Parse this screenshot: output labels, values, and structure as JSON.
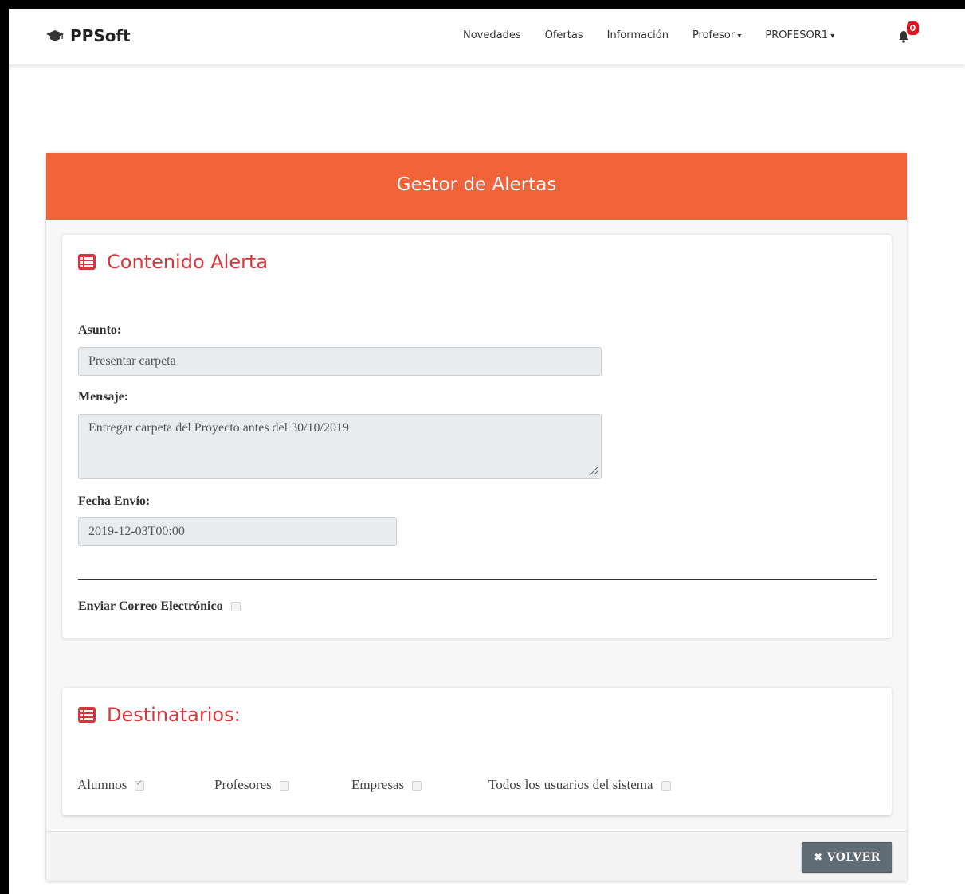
{
  "navbar": {
    "brand": "PPSoft",
    "items": [
      "Novedades",
      "Ofertas",
      "Información",
      "Profesor",
      "PROFESOR1"
    ],
    "notification_count": "0"
  },
  "header": {
    "title": "Gestor de Alertas"
  },
  "contenido": {
    "title": "Contenido Alerta",
    "asunto_label": "Asunto:",
    "asunto_value": "Presentar carpeta",
    "mensaje_label": "Mensaje:",
    "mensaje_value": "Entregar carpeta del Proyecto antes del 30/10/2019",
    "fecha_label": "Fecha Envío:",
    "fecha_value": "2019-12-03T00:00",
    "email_label": "Enviar Correo Electrónico",
    "email_checked": false
  },
  "destinatarios": {
    "title": "Destinatarios:",
    "options": [
      {
        "label": "Alumnos",
        "checked": true
      },
      {
        "label": "Profesores",
        "checked": false
      },
      {
        "label": "Empresas",
        "checked": false
      },
      {
        "label": "Todos los usuarios del sistema",
        "checked": false
      }
    ]
  },
  "footer": {
    "volver_label": "VOLVER"
  },
  "colors": {
    "accent": "#f2633a",
    "title_red": "#d9353b",
    "badge": "#e0141e",
    "button": "#5f6b75"
  },
  "icons": {
    "brand": "graduation-cap-icon",
    "panel": "list-alt-icon",
    "bell": "bell-icon",
    "close": "times-icon"
  }
}
